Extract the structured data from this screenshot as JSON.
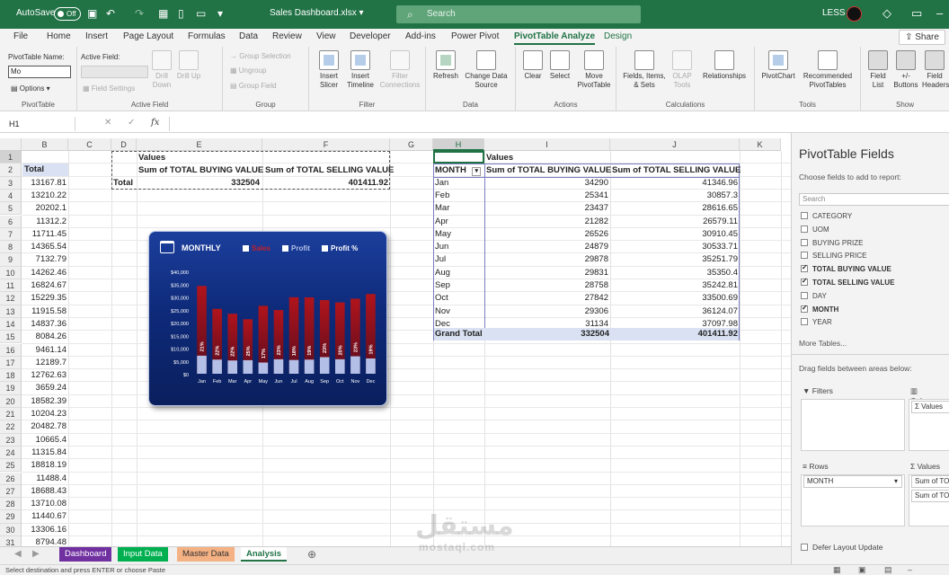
{
  "titlebar": {
    "autosave": "AutoSave",
    "autosave_state": "Off",
    "filename": "Sales Dashboard.xlsx",
    "search_placeholder": "Search",
    "user": "LESS"
  },
  "tabs": [
    "File",
    "Home",
    "Insert",
    "Page Layout",
    "Formulas",
    "Data",
    "Review",
    "View",
    "Developer",
    "Add-ins",
    "Power Pivot",
    "PivotTable Analyze",
    "Design"
  ],
  "active_tab": "PivotTable Analyze",
  "share_label": "Share",
  "ribbon": {
    "pivottable": {
      "name_label": "PivotTable Name:",
      "name_value": "Mo",
      "options": "Options",
      "group": "PivotTable"
    },
    "active_field": {
      "label": "Active Field:",
      "field_settings": "Field Settings",
      "drill_down": "Drill Down",
      "drill_up": "Drill Up",
      "group": "Active Field"
    },
    "group_grp": {
      "selection": "Group Selection",
      "ungroup": "Ungroup",
      "field": "Group Field",
      "group": "Group"
    },
    "filter": {
      "slicer": "Insert Slicer",
      "timeline": "Insert Timeline",
      "connections": "Filter Connections",
      "group": "Filter"
    },
    "data": {
      "refresh": "Refresh",
      "change": "Change Data Source",
      "group": "Data"
    },
    "actions": {
      "clear": "Clear",
      "select": "Select",
      "move": "Move PivotTable",
      "group": "Actions"
    },
    "calculations": {
      "fields": "Fields, Items, & Sets",
      "olap": "OLAP Tools",
      "relationships": "Relationships",
      "group": "Calculations"
    },
    "tools": {
      "pivotchart": "PivotChart",
      "recommended": "Recommended PivotTables",
      "group": "Tools"
    },
    "show": {
      "fieldlist": "Field List",
      "buttons": "+/- Buttons",
      "headers": "Field Headers",
      "group": "Show"
    }
  },
  "formula_bar": {
    "name_box": "H1",
    "cancel": "✕",
    "enter": "✓",
    "fx": "fx",
    "formula": ""
  },
  "columns": [
    "B",
    "C",
    "D",
    "E",
    "F",
    "G",
    "H",
    "I",
    "J",
    "K"
  ],
  "rows": [
    "1",
    "2",
    "3",
    "4",
    "5",
    "6",
    "7",
    "8",
    "9",
    "10",
    "11",
    "12",
    "13",
    "14",
    "15",
    "16",
    "17",
    "18",
    "19",
    "20",
    "21",
    "22",
    "23",
    "24",
    "25",
    "26",
    "27",
    "28",
    "29",
    "30",
    "31"
  ],
  "col_b": {
    "header": "Total",
    "values": [
      "13167.81",
      "13210.22",
      "20202.1",
      "11312.2",
      "11711.45",
      "14365.54",
      "7132.79",
      "14262.46",
      "16824.67",
      "15229.35",
      "11915.58",
      "14837.36",
      "8084.26",
      "9461.14",
      "12189.7",
      "12762.63",
      "3659.24",
      "18582.39",
      "10204.23",
      "20482.78",
      "10665.4",
      "11315.84",
      "18818.19",
      "11488.4",
      "18688.43",
      "13710.08",
      "11440.67",
      "13306.16",
      "8794.48"
    ]
  },
  "pivot_small": {
    "values_label": "Values",
    "col1": "Sum of TOTAL BUYING VALUE",
    "col2": "Sum of TOTAL SELLING VALUE",
    "total_label": "Total",
    "total_buy": "332504",
    "total_sell": "401411.92"
  },
  "pivot_month": {
    "values_label": "Values",
    "row_header": "MONTH",
    "col1": "Sum of TOTAL BUYING VALUE",
    "col2": "Sum of TOTAL SELLING VALUE",
    "rows": [
      {
        "month": "Jan",
        "buy": "34290",
        "sell": "41346.96"
      },
      {
        "month": "Feb",
        "buy": "25341",
        "sell": "30857.3"
      },
      {
        "month": "Mar",
        "buy": "23437",
        "sell": "28616.65"
      },
      {
        "month": "Apr",
        "buy": "21282",
        "sell": "26579.11"
      },
      {
        "month": "May",
        "buy": "26526",
        "sell": "30910.45"
      },
      {
        "month": "Jun",
        "buy": "24879",
        "sell": "30533.71"
      },
      {
        "month": "Jul",
        "buy": "29878",
        "sell": "35251.79"
      },
      {
        "month": "Aug",
        "buy": "29831",
        "sell": "35350.4"
      },
      {
        "month": "Sep",
        "buy": "28758",
        "sell": "35242.81"
      },
      {
        "month": "Oct",
        "buy": "27842",
        "sell": "33500.69"
      },
      {
        "month": "Nov",
        "buy": "29306",
        "sell": "36124.07"
      },
      {
        "month": "Dec",
        "buy": "31134",
        "sell": "37097.98"
      }
    ],
    "grand_total_label": "Grand Total",
    "grand_buy": "332504",
    "grand_sell": "401411.92"
  },
  "chart_data": {
    "type": "bar",
    "title": "MONTHLY",
    "legend": [
      "Sales",
      "Profit",
      "Profit %"
    ],
    "categories": [
      "Jan",
      "Feb",
      "Mar",
      "Apr",
      "May",
      "Jun",
      "Jul",
      "Aug",
      "Sep",
      "Oct",
      "Nov",
      "Dec"
    ],
    "series": [
      {
        "name": "Sales",
        "values": [
          34290,
          25341,
          23437,
          21282,
          26526,
          24879,
          29878,
          29831,
          28758,
          27842,
          29306,
          31134
        ]
      },
      {
        "name": "Profit",
        "values": [
          7057,
          5516,
          5180,
          5297,
          4384,
          5655,
          5374,
          5519,
          6485,
          5659,
          6818,
          5964
        ]
      }
    ],
    "data_labels": [
      "21%",
      "22%",
      "22%",
      "25%",
      "17%",
      "23%",
      "18%",
      "19%",
      "23%",
      "20%",
      "23%",
      "19%"
    ],
    "y_ticks": [
      "$0",
      "$5,000",
      "$10,000",
      "$15,000",
      "$20,000",
      "$25,000",
      "$30,000",
      "$35,000",
      "$40,000"
    ],
    "ylim": [
      0,
      40000
    ],
    "colors": {
      "sales": "#b0141c",
      "profit": "#b3bfe6"
    }
  },
  "pane": {
    "title": "PivotTable Fields",
    "subtitle": "Choose fields to add to report:",
    "search_placeholder": "Search",
    "fields": [
      {
        "name": "CATEGORY",
        "checked": false
      },
      {
        "name": "UOM",
        "checked": false
      },
      {
        "name": "BUYING PRIZE",
        "checked": false
      },
      {
        "name": "SELLING PRICE",
        "checked": false
      },
      {
        "name": "TOTAL BUYING VALUE",
        "checked": true
      },
      {
        "name": "TOTAL SELLING VALUE",
        "checked": true
      },
      {
        "name": "DAY",
        "checked": false
      },
      {
        "name": "MONTH",
        "checked": true
      },
      {
        "name": "YEAR",
        "checked": false
      }
    ],
    "more_tables": "More Tables...",
    "drag_hint": "Drag fields between areas below:",
    "filters": "Filters",
    "columns": "Columns",
    "columns_chip": "Σ Values",
    "rows": "Rows",
    "rows_chip": "MONTH",
    "values": "Values",
    "values_chips": [
      "Sum of TOTAL BUYING VALUE",
      "Sum of TOTAL SELLING VALUE"
    ],
    "defer": "Defer Layout Update"
  },
  "sheet_tabs": [
    "Dashboard",
    "Input Data",
    "Master Data",
    "Analysis"
  ],
  "status": "Select destination and press ENTER or choose Paste",
  "watermark": {
    "big": "مستقل",
    "small": "mostaql.com"
  }
}
